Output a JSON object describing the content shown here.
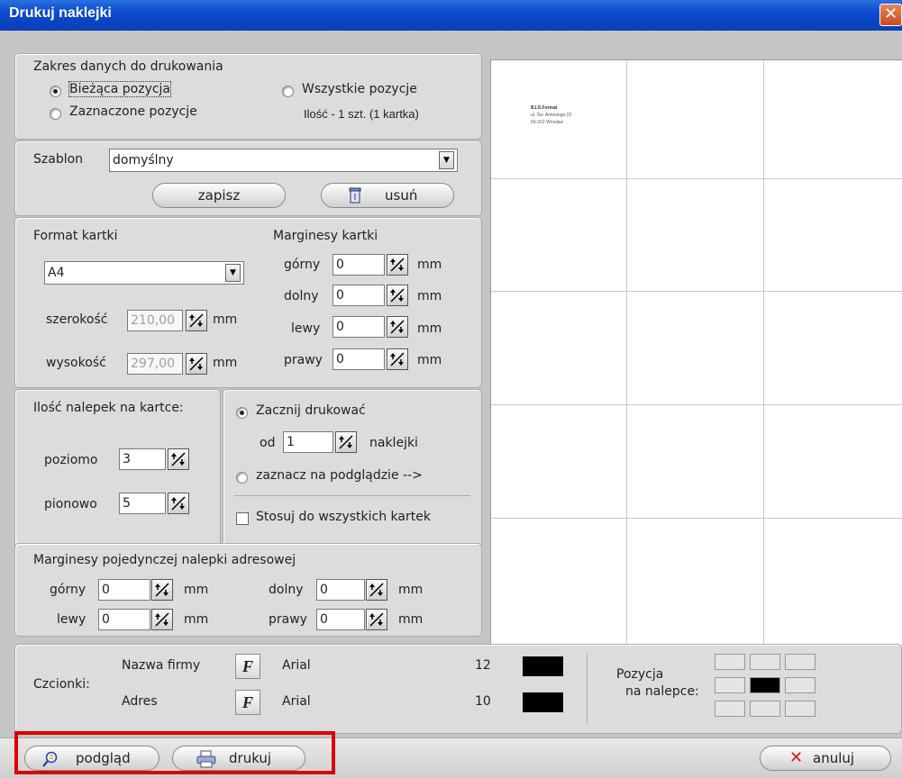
{
  "window": {
    "title": "Drukuj naklejki",
    "close_glyph": "✕"
  },
  "range": {
    "title": "Zakres danych do drukowania",
    "current": "Bieżąca pozycja",
    "all": "Wszystkie pozycje",
    "selected": "Zaznaczone pozycje",
    "count": "Ilość - 1 szt. (1 kartka)",
    "checked": "current"
  },
  "template": {
    "label": "Szablon",
    "value": "domyślny",
    "save_label": "zapisz",
    "delete_label": "usuń"
  },
  "sheet": {
    "format_title": "Format kartki",
    "format_value": "A4",
    "width_label": "szerokość",
    "width_value": "210,00",
    "height_label": "wysokość",
    "height_value": "297,00",
    "unit": "mm"
  },
  "margins": {
    "title": "Marginesy kartki",
    "top_label": "górny",
    "top": "0",
    "bottom_label": "dolny",
    "bottom": "0",
    "left_label": "lewy",
    "left": "0",
    "right_label": "prawy",
    "right": "0",
    "unit": "mm"
  },
  "labels_count": {
    "title": "Ilość nalepek na kartce:",
    "horiz_label": "poziomo",
    "horiz": "3",
    "vert_label": "pionowo",
    "vert": "5"
  },
  "start": {
    "start_label": "Zacznij drukować",
    "from_label": "od",
    "from_value": "1",
    "unit": "naklejki",
    "mark_label": "zaznacz na podglądzie -->",
    "apply_all_label": "Stosuj do wszystkich kartek",
    "checked": "start",
    "apply_all": false
  },
  "label_margins": {
    "title": "Marginesy pojedynczej nalepki adresowej",
    "top_label": "górny",
    "top": "0",
    "bottom_label": "dolny",
    "bottom": "0",
    "left_label": "lewy",
    "left": "0",
    "right_label": "prawy",
    "right": "0",
    "unit": "mm"
  },
  "fonts": {
    "label": "Czcionki:",
    "company_label": "Nazwa firmy",
    "company_font": "Arial",
    "company_size": "12",
    "company_color": "#000000",
    "address_label": "Adres",
    "address_font": "Arial",
    "address_size": "10",
    "address_color": "#000000",
    "f_glyph": "F",
    "position_label_1": "Pozycja",
    "position_label_2": "na nalepce:"
  },
  "preview": {
    "lines": [
      "B.I.S.Format",
      "ul. Św. Antoniego 23",
      "50-312 Wrocław"
    ],
    "cols": 3,
    "rows": 5
  },
  "bottom": {
    "preview_label": "podgląd",
    "print_label": "drukuj",
    "cancel_label": "anuluj"
  },
  "colors": {
    "title_bar": "#0c4bd0",
    "highlight": "#e00000",
    "cancel_x": "#d01818"
  }
}
